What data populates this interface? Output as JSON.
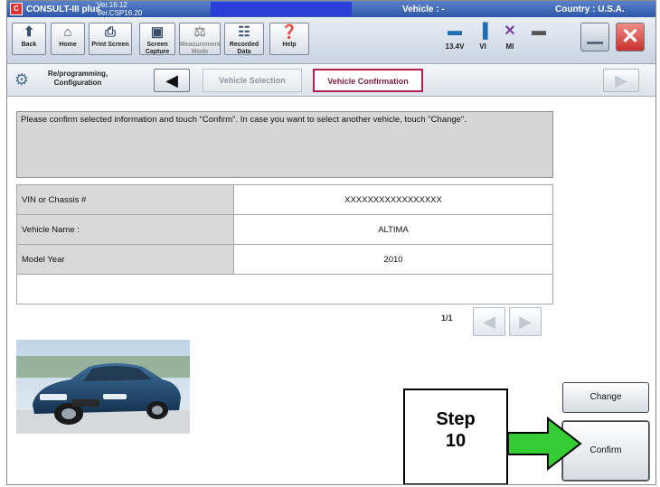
{
  "titlebar": {
    "logo": "C",
    "app_name": "CONSULT-III plus",
    "version_1": "Ver.16.12",
    "version_2": "Ver.CSP16.20",
    "vehicle": "Vehicle : -",
    "country": "Country : U.S.A."
  },
  "toolbar": {
    "back": "Back",
    "home": "Home",
    "print_screen": "Print Screen",
    "screen_capture": "Screen Capture",
    "measurement_mode": "Measurement Mode",
    "recorded_data": "Recorded Data",
    "help": "Help",
    "battery_voltage": "13.4V",
    "vi": "VI",
    "mi": "MI"
  },
  "nav": {
    "section": "Re/programming, Configuration",
    "crumb_vehicle_selection": "Vehicle Selection",
    "crumb_vehicle_confirmation": "Vehicle Confirmation"
  },
  "main": {
    "message": "Please confirm selected information and touch \"Confirm\". In case you want to select another vehicle, touch \"Change\".",
    "rows": [
      {
        "label": "VIN or Chassis #",
        "value": "XXXXXXXXXXXXXXXXX"
      },
      {
        "label": "Vehicle Name :",
        "value": "ALTIMA"
      },
      {
        "label": "Model Year",
        "value": "2010"
      }
    ],
    "pager": "1/1"
  },
  "buttons": {
    "change": "Change",
    "confirm": "Confirm"
  },
  "annotation": {
    "step_word": "Step",
    "step_number": "10",
    "arrow_color": "#33cc33"
  },
  "colors": {
    "titlebar": "#2f57a8",
    "highlight": "#2a3ed8",
    "active_crumb_border": "#b0204e",
    "close_button": "#d9534f"
  }
}
